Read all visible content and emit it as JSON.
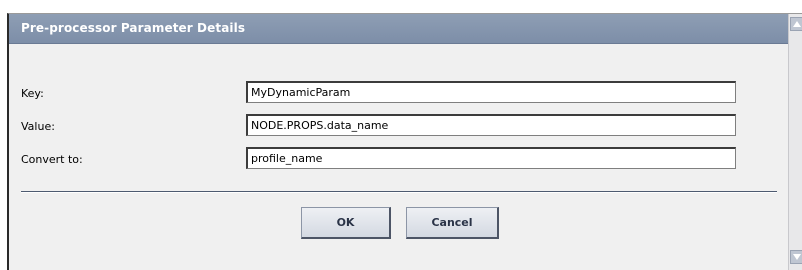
{
  "dialog": {
    "title": "Pre-processor Parameter Details"
  },
  "form": {
    "fields": [
      {
        "label": "Key:",
        "value": "MyDynamicParam"
      },
      {
        "label": "Value:",
        "value": "NODE.PROPS.data_name"
      },
      {
        "label": "Convert to:",
        "value": "profile_name"
      }
    ]
  },
  "buttons": {
    "ok_label": "OK",
    "cancel_label": "Cancel"
  },
  "colors": {
    "titlebar": "#8e9eb4",
    "panel_bg": "#f0f0f0",
    "button_text": "#2a3347"
  },
  "icons": {
    "scroll_up": "triangle-up",
    "scroll_down": "triangle-down"
  }
}
